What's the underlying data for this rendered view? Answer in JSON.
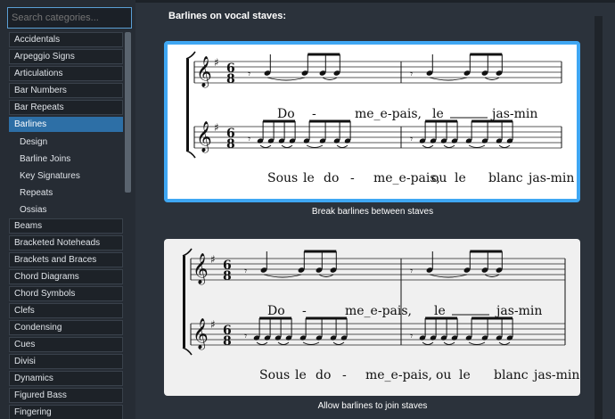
{
  "search": {
    "placeholder": "Search categories..."
  },
  "categories_top": [
    "Accidentals",
    "Arpeggio Signs",
    "Articulations",
    "Bar Numbers",
    "Bar Repeats"
  ],
  "selected_category": "Barlines",
  "subcategories": [
    "Design",
    "Barline Joins",
    "Key Signatures",
    "Repeats",
    "Ossias"
  ],
  "categories_bottom": [
    "Beams",
    "Bracketed Noteheads",
    "Brackets and Braces",
    "Chord Diagrams",
    "Chord Symbols",
    "Clefs",
    "Condensing",
    "Cues",
    "Divisi",
    "Dynamics",
    "Figured Bass",
    "Fingering"
  ],
  "main": {
    "section_title": "Barlines on vocal staves:",
    "options": [
      {
        "caption": "Break barlines between staves",
        "selected": true,
        "lyrics_top": [
          "Do",
          "-",
          "me_e-pais,",
          "le",
          "jas-min"
        ],
        "lyrics_bottom": [
          "Sous",
          "le",
          "do",
          "-",
          "me_e-pais,",
          "ou",
          "le",
          "blanc",
          "jas-min"
        ]
      },
      {
        "caption": "Allow barlines to join staves",
        "selected": false,
        "lyrics_top": [
          "Do",
          "-",
          "me_e-pais,",
          "le",
          "jas-min"
        ],
        "lyrics_bottom": [
          "Sous",
          "le",
          "do",
          "-",
          "me_e-pais,",
          "ou",
          "le",
          "blanc",
          "jas-min"
        ]
      }
    ],
    "time_signature": {
      "numerator": "6",
      "denominator": "8"
    }
  },
  "colors": {
    "accent": "#3fa7f3",
    "selected_item": "#2d6fa6",
    "panel": "#262c34",
    "background": "#2b323b"
  }
}
